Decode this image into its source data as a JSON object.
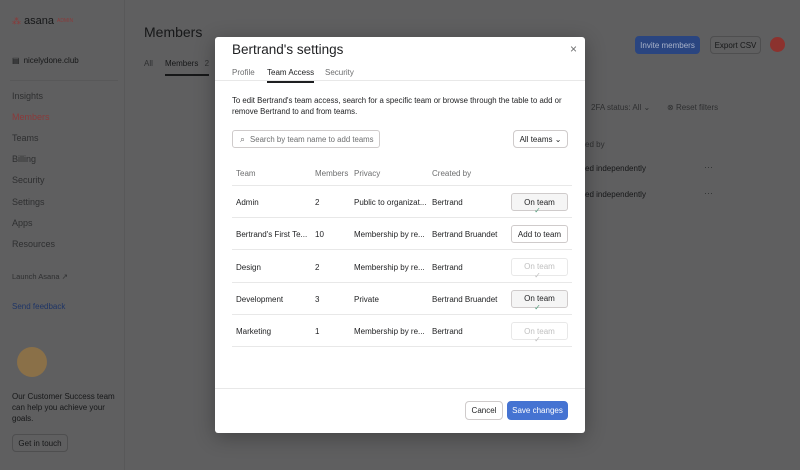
{
  "sidebar": {
    "logo": "asana",
    "logo_badge": "ADMIN",
    "org": "nicelydone.club",
    "items": [
      "Insights",
      "Members",
      "Teams",
      "Billing",
      "Security",
      "Settings",
      "Apps",
      "Resources"
    ],
    "launch": "Launch Asana",
    "feedback": "Send feedback",
    "cs_text": "Our Customer Success team can help you achieve your goals.",
    "cs_button": "Get in touch"
  },
  "main": {
    "title": "Members",
    "tabs": [
      {
        "label": "All"
      },
      {
        "label": "Members",
        "count": "2"
      }
    ],
    "invite": "Invite members",
    "export": "Export CSV",
    "filter_2fa": "2FA status: All",
    "reset": "Reset filters",
    "col_partial": "ed by",
    "rows": [
      "ed independently",
      "ed independently"
    ]
  },
  "modal": {
    "title": "Bertrand's settings",
    "tabs": [
      "Profile",
      "Team Access",
      "Security"
    ],
    "active_tab": "Team Access",
    "description": "To edit Bertrand's team access, search for a specific team or browse through the table to add or remove Bertrand to and from teams.",
    "search_placeholder": "Search by team name to add teams",
    "filter": "All teams",
    "columns": [
      "Team",
      "Members",
      "Privacy",
      "Created by"
    ],
    "rows": [
      {
        "team": "Admin",
        "members": "2",
        "privacy": "Public to organizat...",
        "created_by": "Bertrand",
        "action": "On team",
        "state": "on"
      },
      {
        "team": "Bertrand's First Te...",
        "members": "10",
        "privacy": "Membership by re...",
        "created_by": "Bertrand Bruandet",
        "action": "Add to team",
        "state": "add"
      },
      {
        "team": "Design",
        "members": "2",
        "privacy": "Membership by re...",
        "created_by": "Bertrand",
        "action": "On team",
        "state": "disabled"
      },
      {
        "team": "Development",
        "members": "3",
        "privacy": "Private",
        "created_by": "Bertrand Bruandet",
        "action": "On team",
        "state": "on"
      },
      {
        "team": "Marketing",
        "members": "1",
        "privacy": "Membership by re...",
        "created_by": "Bertrand",
        "action": "On team",
        "state": "disabled"
      }
    ],
    "cancel": "Cancel",
    "save": "Save changes"
  },
  "colors": {
    "accent": "#4573d2",
    "brand": "#f06a6a"
  }
}
